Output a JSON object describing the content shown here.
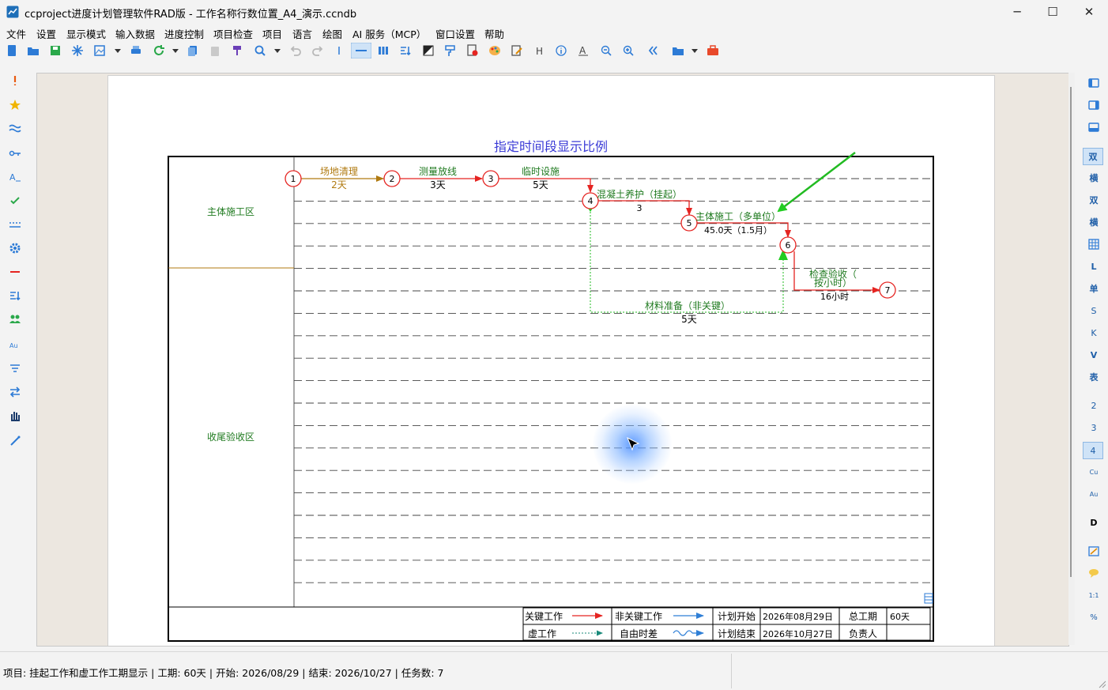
{
  "window": {
    "title": "ccproject进度计划管理软件RAD版 - 工作名称行数位置_A4_演示.ccndb",
    "minimize_glyph": "─",
    "maximize_glyph": "☐",
    "close_glyph": "✕"
  },
  "menu": [
    "文件",
    "设置",
    "显示模式",
    "输入数据",
    "进度控制",
    "项目检查",
    "项目",
    "语言",
    "绘图",
    "AI 服务（MCP）",
    "窗口设置",
    "帮助"
  ],
  "toolbar_icons": [
    "new-file-icon",
    "open-folder-icon",
    "save-icon",
    "snowflake-icon",
    "image-export-icon",
    "dropdown-icon",
    "print-icon",
    "refresh-icon",
    "dropdown-icon",
    "copy-icon",
    "paste-icon",
    "paint-brush-icon",
    "search-icon",
    "dropdown-icon",
    "undo-icon",
    "redo-icon",
    "cursor-icon",
    "line-mode-icon",
    "columns-icon",
    "sort-icon",
    "contrast-icon",
    "format-painter-icon",
    "document-settings-icon",
    "palette-icon",
    "edit-icon",
    "h-icon",
    "info-icon",
    "text-a-icon",
    "zoom-out-icon",
    "zoom-in-icon",
    "collapse-icon",
    "folder-icon",
    "dropdown-icon",
    "toolbox-icon"
  ],
  "left_tools": [
    "exclamation-icon",
    "star-icon",
    "wave-icon",
    "key-icon",
    "text-a-icon",
    "check-icon",
    "dotted-line-icon",
    "gear-icon",
    "minus-icon",
    "sort-list-icon",
    "users-icon",
    "font-au-icon",
    "filter-icon",
    "swap-icon",
    "hand-icon",
    "wand-icon"
  ],
  "right_tools": {
    "labels": [
      "",
      "",
      "",
      "双",
      "横",
      "双",
      "横",
      "",
      "L",
      "单",
      "S",
      "K",
      "V",
      "表",
      "2",
      "3",
      "4",
      "Cu",
      "Au",
      "D",
      "",
      "",
      "1:1",
      "%"
    ]
  },
  "chart": {
    "title": "指定时间段显示比例",
    "zones": [
      "主体施工区",
      "收尾验收区"
    ],
    "nodes": [
      "1",
      "2",
      "3",
      "4",
      "5",
      "6",
      "7"
    ],
    "tasks": [
      {
        "name": "场地清理",
        "duration": "2天"
      },
      {
        "name": "测量放线",
        "duration": "3天"
      },
      {
        "name": "临时设施",
        "duration": "5天"
      },
      {
        "name": "混凝土养护（挂起）",
        "duration": "3"
      },
      {
        "name": "主体施工（多单位）",
        "duration": "45.0天（1.5月）"
      },
      {
        "name_line1": "检查验收（",
        "name_line2": "按小时）",
        "duration": "16小时"
      },
      {
        "name": "材料准备（非关键）",
        "duration": "5天"
      }
    ],
    "colors": {
      "critical": "#e52421",
      "noncritical": "#2f7fd6",
      "dummy": "#1a8a7a",
      "label_green": "#1f7a1f",
      "label_orange": "#b07a10",
      "title_blue": "#3a3ad6",
      "annotation_arrow": "#22bb22"
    }
  },
  "legend": {
    "critical": "关键工作",
    "noncritical": "非关键工作",
    "dummy": "虚工作",
    "free_float": "自由时差",
    "plan_start_label": "计划开始",
    "plan_start_value": "2026年08月29日",
    "plan_end_label": "计划结束",
    "plan_end_value": "2026年10月27日",
    "total_duration_label": "总工期",
    "total_duration_value": "60天",
    "owner_label": "负责人",
    "owner_value": ""
  },
  "status": {
    "text": "项目: 挂起工作和虚工作工期显示 | 工期: 60天 | 开始: 2026/08/29 | 结束: 2026/10/27 | 任务数: 7"
  }
}
